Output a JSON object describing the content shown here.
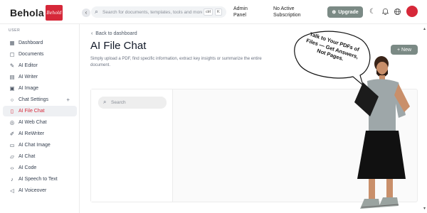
{
  "header": {
    "logo": "Behola",
    "badge_text": "Behold",
    "search_placeholder": "Search for documents, templates, tools and more...",
    "shortcut_key1": "ctrl",
    "shortcut_key2": "K",
    "admin_panel": "Admin Panel",
    "subscription": "No Active Subscription",
    "upgrade_label": "Upgrade"
  },
  "sidebar": {
    "section": "USER",
    "items": [
      {
        "label": "Dashboard",
        "icon": "grid-icon"
      },
      {
        "label": "Documents",
        "icon": "folder-icon"
      },
      {
        "label": "AI Editor",
        "icon": "edit-icon"
      },
      {
        "label": "AI Writer",
        "icon": "document-icon"
      },
      {
        "label": "AI Image",
        "icon": "image-icon"
      },
      {
        "label": "Chat Settings",
        "icon": "chat-bubble-icon"
      },
      {
        "label": "AI File Chat",
        "icon": "file-icon"
      },
      {
        "label": "AI Web Chat",
        "icon": "globe-icon"
      },
      {
        "label": "AI ReWriter",
        "icon": "pen-icon"
      },
      {
        "label": "AI Chat Image",
        "icon": "chat-image-icon"
      },
      {
        "label": "AI Chat",
        "icon": "chat-icon"
      },
      {
        "label": "AI Code",
        "icon": "code-icon"
      },
      {
        "label": "AI Speech to Text",
        "icon": "microphone-icon"
      },
      {
        "label": "AI Voiceover",
        "icon": "speaker-icon"
      }
    ]
  },
  "main": {
    "back_label": "Back to dashboard",
    "title": "AI File Chat",
    "description": "Simply upload a PDF, find specific information, extract key insights or summarize the entire document.",
    "new_label": "New",
    "chat_search_placeholder": "Search"
  },
  "promo": {
    "text": "Talk to Your PDFs of Files — Get Answers, Not Pages."
  },
  "colors": {
    "accent": "#d62839",
    "button": "#7b8a85"
  }
}
